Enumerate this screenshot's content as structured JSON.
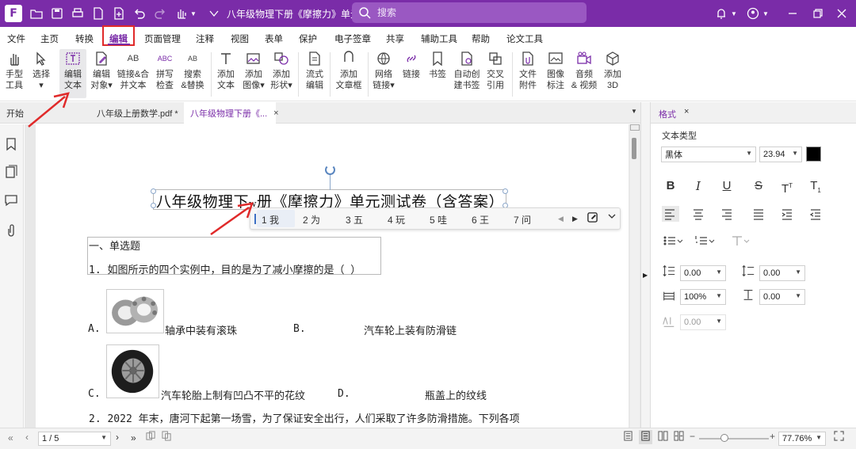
{
  "titlebar": {
    "logo": "F",
    "doc_title": "八年级物理下册《摩擦力》单元...",
    "search_placeholder": "搜索"
  },
  "menu": {
    "items": [
      "文件",
      "主页",
      "转换",
      "编辑",
      "页面管理",
      "注释",
      "视图",
      "表单",
      "保护",
      "电子签章",
      "共享",
      "辅助工具",
      "帮助",
      "论文工具"
    ],
    "active": "编辑"
  },
  "ribbon": {
    "buttons": [
      {
        "l1": "手型",
        "l2": "工具"
      },
      {
        "l1": "选择",
        "l2": "▾"
      },
      {
        "l1": "编辑",
        "l2": "文本"
      },
      {
        "l1": "编辑",
        "l2": "对象▾"
      },
      {
        "l1": "链接&合",
        "l2": "并文本"
      },
      {
        "l1": "拼写",
        "l2": "检查"
      },
      {
        "l1": "搜索",
        "l2": "&替换"
      },
      {
        "l1": "添加",
        "l2": "文本"
      },
      {
        "l1": "添加",
        "l2": "图像▾"
      },
      {
        "l1": "添加",
        "l2": "形状▾"
      },
      {
        "l1": "流式",
        "l2": "编辑"
      },
      {
        "l1": "添加",
        "l2": "文章框"
      },
      {
        "l1": "网络",
        "l2": "链接▾"
      },
      {
        "l1": "链接",
        "l2": ""
      },
      {
        "l1": "书签",
        "l2": ""
      },
      {
        "l1": "自动创",
        "l2": "建书签"
      },
      {
        "l1": "交叉",
        "l2": "引用"
      },
      {
        "l1": "文件",
        "l2": "附件"
      },
      {
        "l1": "图像",
        "l2": "标注"
      },
      {
        "l1": "音频",
        "l2": "& 视频"
      },
      {
        "l1": "添加",
        "l2": "3D"
      }
    ]
  },
  "tabs": {
    "start": "开始",
    "tab1": "八年级上册数学.pdf *",
    "tab2": "八年级物理下册《...",
    "close": "×"
  },
  "document": {
    "heading_a": "八年级物理下",
    "heading_b": "w",
    "heading_c": "册《摩擦力》单元测试卷（含答案）",
    "section": "一、单选题",
    "q1": "1. 如图所示的四个实例中，目的是为了减小摩擦的是（      ）",
    "optA": "A.",
    "optA_text": "轴承中装有滚珠",
    "optB": "B.",
    "optB_text": "汽车轮上装有防滑链",
    "optC": "C.",
    "optC_text": "汽车轮胎上制有凹凸不平的花纹",
    "optD": "D.",
    "optD_text": "瓶盖上的纹线",
    "q2": "2. 2022 年末，唐河下起第一场雪，为了保证安全出行，人们采取了许多防滑措施。下列各项"
  },
  "ime": {
    "candidates": [
      "1 我",
      "2 为",
      "3 五",
      "4 玩",
      "5 哇",
      "6 王",
      "7 问"
    ]
  },
  "format_panel": {
    "tab": "格式",
    "close": "×",
    "text_type_label": "文本类型",
    "font_name": "黑体",
    "font_size": "23.94",
    "color": "#000000",
    "line_spacing": "0.00",
    "para_spacing": "0.00",
    "scale": "100%",
    "baseline": "0.00",
    "char_spacing": "0.00"
  },
  "status": {
    "page": "1 / 5",
    "zoom": "77.76%"
  },
  "colors": {
    "brand": "#7a2ca8",
    "annotation": "#e02a2a"
  }
}
